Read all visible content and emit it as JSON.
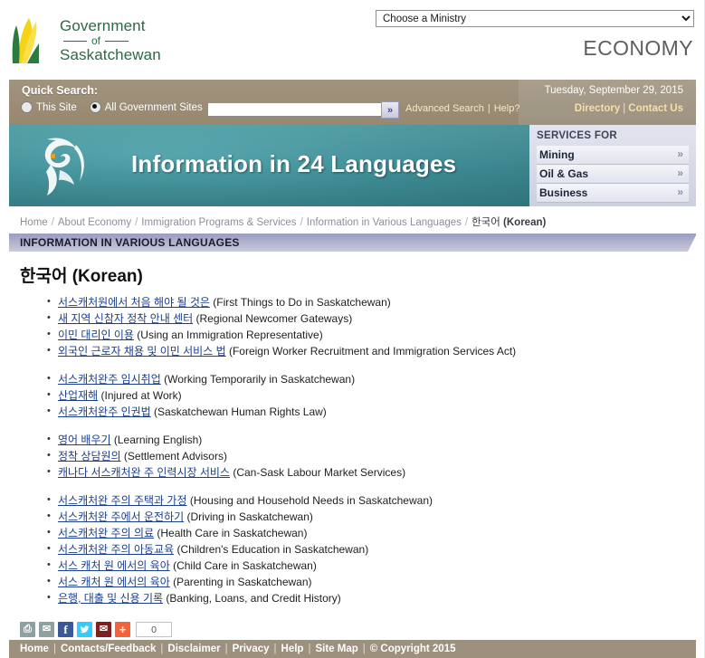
{
  "header": {
    "logo": {
      "line1": "Government",
      "line2": "of",
      "line3": "Saskatchewan"
    },
    "ministry_select_value": "Choose a Ministry",
    "site_name": "ECONOMY"
  },
  "quick_search": {
    "label": "Quick Search:",
    "option_this_site": "This Site",
    "option_all_sites": "All Government Sites",
    "selected": "All Government Sites",
    "input_value": "",
    "input_placeholder": "",
    "go_label": "»",
    "advanced_search": "Advanced Search",
    "help": "Help?",
    "separator": "|",
    "date": "Tuesday, September 29, 2015",
    "directory": "Directory",
    "contact_us": "Contact Us"
  },
  "banner": {
    "title": "Information in 24 Languages",
    "globe_icon": "globe-icon"
  },
  "services": {
    "title": "SERVICES FOR",
    "items": [
      {
        "label": "Mining",
        "chevron": "»"
      },
      {
        "label": "Oil & Gas",
        "chevron": "»"
      },
      {
        "label": "Business",
        "chevron": "»"
      }
    ]
  },
  "breadcrumb": {
    "separator": "/",
    "items": [
      "Home",
      "About Economy",
      "Immigration Programs & Services",
      "Information in Various Languages"
    ],
    "current_korean": "한국어",
    "current_english": "(Korean)"
  },
  "section_bar": {
    "title": "INFORMATION IN VARIOUS LANGUAGES"
  },
  "page": {
    "title": "한국어 (Korean)",
    "link_groups": [
      {
        "items": [
          {
            "ko": "서스캐처원에서 처음 해야 될 것은",
            "en": "(First Things to Do in Saskatchewan)"
          },
          {
            "ko": "새 지역 신참자 정착 안내 센터",
            "en": "(Regional Newcomer Gateways)"
          },
          {
            "ko": "이민 대리인 이용",
            "en": "(Using an Immigration Representative)"
          },
          {
            "ko": "외국인 근로자 채용 및 이민 서비스 법",
            "en": "(Foreign Worker Recruitment and Immigration Services Act)"
          }
        ]
      },
      {
        "items": [
          {
            "ko": "서스캐처완주 임시취업",
            "en": "(Working Temporarily in Saskatchewan)"
          },
          {
            "ko": "산업재해",
            "en": "(Injured at Work)"
          },
          {
            "ko": "서스캐처완주 인권법",
            "en": "(Saskatchewan Human Rights Law)"
          }
        ]
      },
      {
        "items": [
          {
            "ko": "영어 배우기",
            "en": "(Learning English)"
          },
          {
            "ko": "정착 상담원의",
            "en": "(Settlement Advisors)"
          },
          {
            "ko": "캐나다 서스캐처완 주 인력시장  서비스",
            "en": "(Can-Sask Labour Market Services)"
          }
        ]
      },
      {
        "items": [
          {
            "ko": "서스캐처완 주의 주택과 가정",
            "en": "(Housing and Household Needs in Saskatchewan)"
          },
          {
            "ko": "서스캐처완 주에서 운전하기",
            "en": "(Driving in Saskatchewan)"
          },
          {
            "ko": "서스캐처완 주의 의료",
            "en": "(Health Care in Saskatchewan)"
          },
          {
            "ko": "서스캐처완 주의 아동교육",
            "en": "(Children's Education in Saskatchewan)"
          },
          {
            "ko": "서스 캐처 원 에서의 육아",
            "en": "(Child Care in Saskatchewan)"
          },
          {
            "ko": "서스 캐처 원 에서의 육아",
            "en": "(Parenting in Saskatchewan)"
          },
          {
            "ko": "은행, 대출 및 신용 기록",
            "en": "(Banking, Loans, and Credit History)"
          }
        ]
      }
    ]
  },
  "share": {
    "buttons": [
      {
        "icon": "print-icon",
        "glyph": "⎙"
      },
      {
        "icon": "email-icon",
        "glyph": "✉"
      },
      {
        "icon": "facebook-icon",
        "glyph": "f"
      },
      {
        "icon": "twitter-icon",
        "glyph": "🐦"
      },
      {
        "icon": "mail-icon",
        "glyph": "✉"
      },
      {
        "icon": "addthis-plus-icon",
        "glyph": "+"
      }
    ],
    "count": "0"
  },
  "footer": {
    "separator": "|",
    "links": [
      "Home",
      "Contacts/Feedback",
      "Disclaimer",
      "Privacy",
      "Help",
      "Site Map"
    ],
    "copyright": "© Copyright 2015"
  },
  "colors": {
    "tan": "#9d917e",
    "teal": "#3e8f98",
    "periwinkle": "#b4b6d0",
    "link_blue": "#1b3f8f",
    "logo_green": "#2b6a43",
    "logo_yellow": "#f5d316"
  }
}
